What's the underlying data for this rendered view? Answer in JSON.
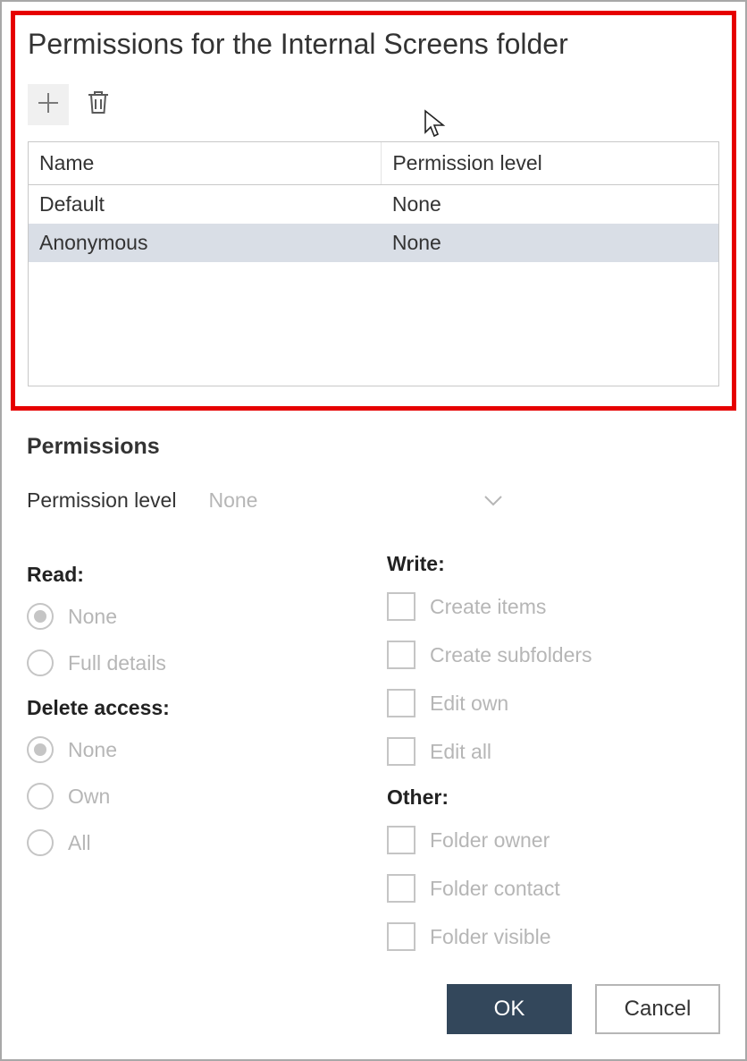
{
  "title": "Permissions for the Internal Screens folder",
  "toolbar": {
    "add_icon": "plus-icon",
    "delete_icon": "trash-icon"
  },
  "table": {
    "headers": {
      "name": "Name",
      "level": "Permission level"
    },
    "rows": [
      {
        "name": "Default",
        "level": "None",
        "selected": false
      },
      {
        "name": "Anonymous",
        "level": "None",
        "selected": true
      }
    ]
  },
  "permissions": {
    "section_title": "Permissions",
    "level_label": "Permission level",
    "level_value": "None",
    "read": {
      "label": "Read:",
      "options": [
        {
          "label": "None",
          "checked": true
        },
        {
          "label": "Full details",
          "checked": false
        }
      ]
    },
    "delete": {
      "label": "Delete access:",
      "options": [
        {
          "label": "None",
          "checked": true
        },
        {
          "label": "Own",
          "checked": false
        },
        {
          "label": "All",
          "checked": false
        }
      ]
    },
    "write": {
      "label": "Write:",
      "options": [
        {
          "label": "Create items",
          "checked": false
        },
        {
          "label": "Create subfolders",
          "checked": false
        },
        {
          "label": "Edit own",
          "checked": false
        },
        {
          "label": "Edit all",
          "checked": false
        }
      ]
    },
    "other": {
      "label": "Other:",
      "options": [
        {
          "label": "Folder owner",
          "checked": false
        },
        {
          "label": "Folder contact",
          "checked": false
        },
        {
          "label": "Folder visible",
          "checked": false
        }
      ]
    }
  },
  "buttons": {
    "ok": "OK",
    "cancel": "Cancel"
  }
}
